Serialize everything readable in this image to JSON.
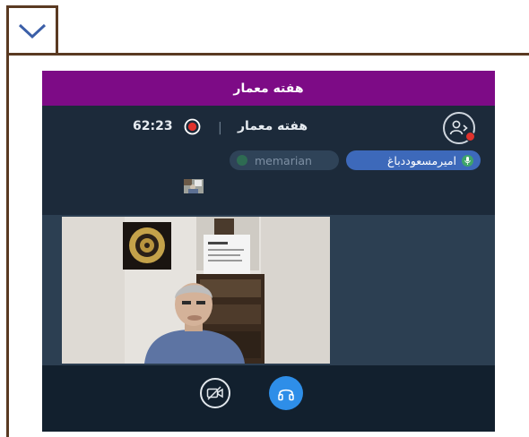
{
  "embed": {
    "collapse_icon": "chevron-down-icon"
  },
  "meeting": {
    "title": "هفته معمار",
    "name": "هفته معمار",
    "divider": "|",
    "elapsed": "62:23",
    "recording": true
  },
  "participants": [
    {
      "name": "امیرمسعوددباغ",
      "active": true,
      "mic_icon": "mic-icon"
    },
    {
      "name": "memarian",
      "active": false
    }
  ],
  "controls": {
    "camera_icon": "camera-off-icon",
    "audio_icon": "headphones-icon"
  },
  "colors": {
    "title_bar": "#7d0b86",
    "app_bg": "#1c2a3a",
    "frame": "#5a3a22",
    "active_chip": "#3d69ba",
    "audio_button": "#2e8ee8",
    "record": "#e0322d"
  }
}
